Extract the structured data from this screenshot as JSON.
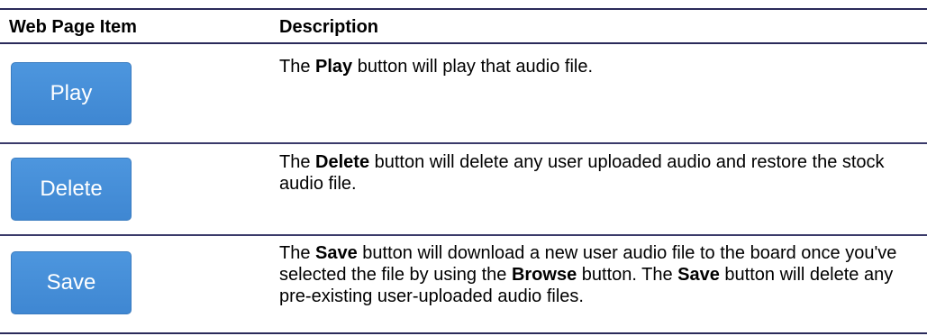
{
  "header": {
    "col_item": "Web Page Item",
    "col_description": "Description"
  },
  "rows": [
    {
      "button_label": "Play",
      "description": {
        "p1": "The ",
        "b1": "Play",
        "p2": " button will play that audio file."
      }
    },
    {
      "button_label": "Delete",
      "description": {
        "p1": "The ",
        "b1": "Delete",
        "p2": " button will delete any user uploaded audio and restore the stock audio file."
      }
    },
    {
      "button_label": "Save",
      "description": {
        "p1": "The ",
        "b1": "Save",
        "p2": " button will download a new user audio file to the board once you've selected the file by using the ",
        "b2": "Browse",
        "p3": " button. The ",
        "b3": "Save",
        "p4": " button will delete any pre-existing user-uploaded audio files."
      }
    }
  ],
  "colors": {
    "button_bg": "#428bca",
    "rule": "#2a2a5a"
  }
}
